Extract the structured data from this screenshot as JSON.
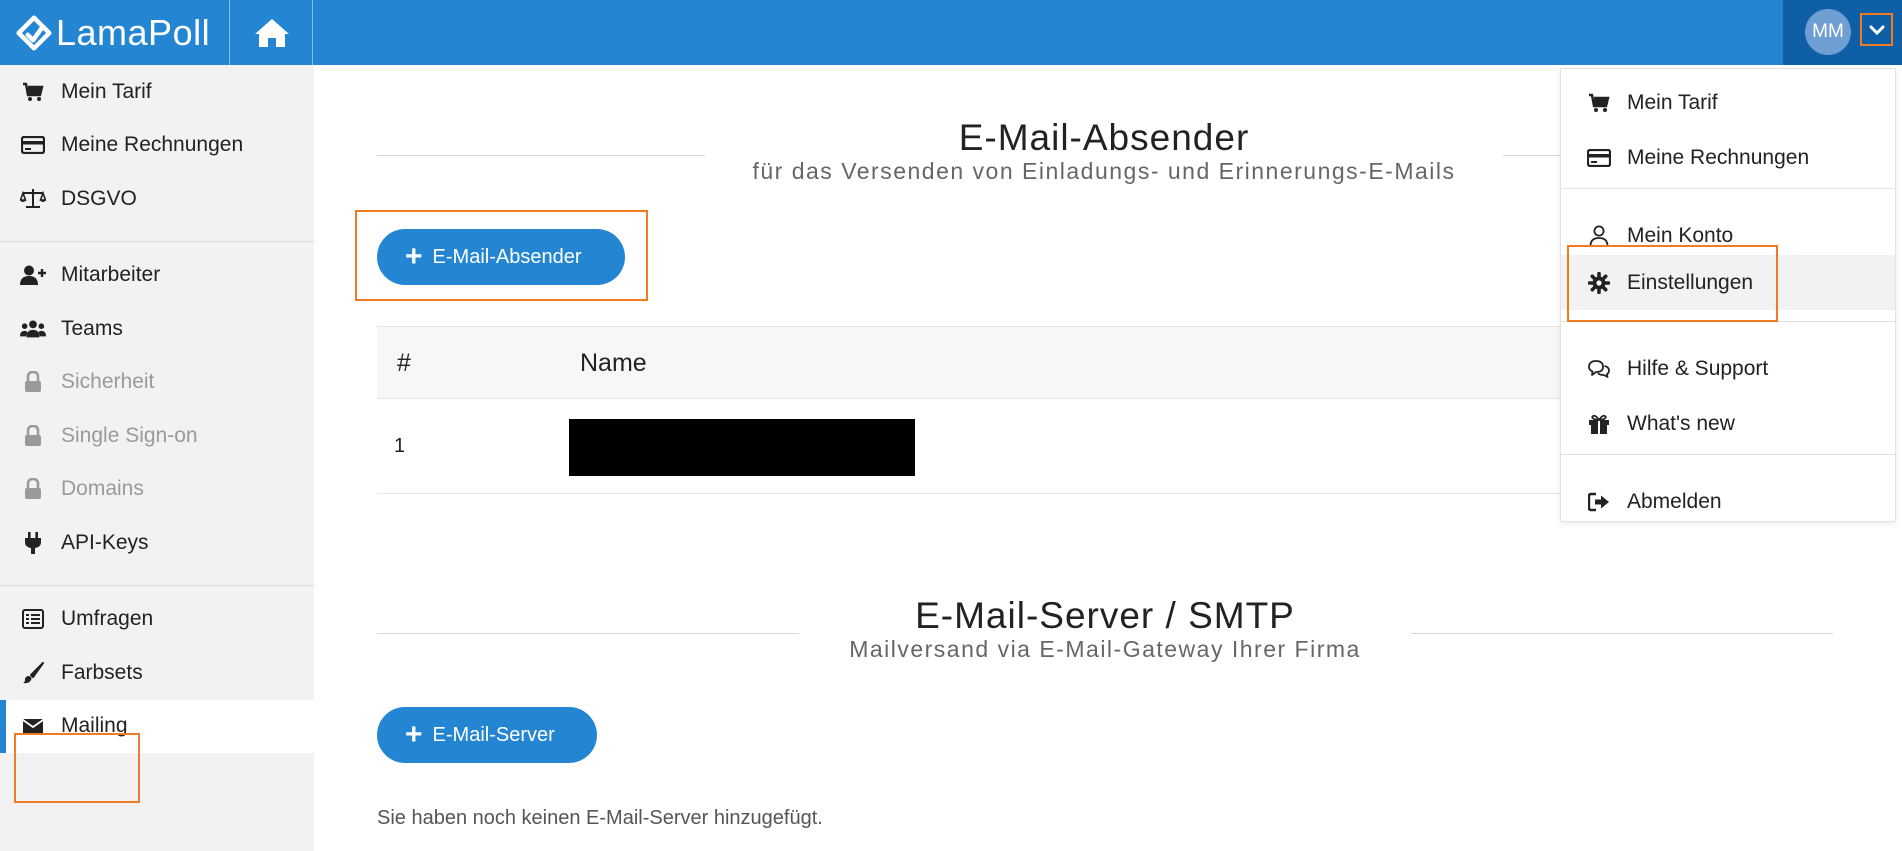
{
  "brand": {
    "name": "LamaPoll"
  },
  "user": {
    "initials": "MM"
  },
  "colors": {
    "primary": "#2486d2",
    "highlight": "#f07b22",
    "user_area": "#0e5fa5"
  },
  "sidebar": {
    "groups": [
      [
        {
          "label": "Mein Tarif",
          "icon": "cart-icon"
        },
        {
          "label": "Meine Rechnungen",
          "icon": "credit-card-icon"
        },
        {
          "label": "DSGVO",
          "icon": "scale-icon"
        }
      ],
      [
        {
          "label": "Mitarbeiter",
          "icon": "user-plus-icon"
        },
        {
          "label": "Teams",
          "icon": "users-icon"
        },
        {
          "label": "Sicherheit",
          "icon": "lock-icon",
          "disabled": true
        },
        {
          "label": "Single Sign-on",
          "icon": "lock-icon",
          "disabled": true
        },
        {
          "label": "Domains",
          "icon": "lock-icon",
          "disabled": true
        },
        {
          "label": "API-Keys",
          "icon": "plug-icon"
        }
      ],
      [
        {
          "label": "Umfragen",
          "icon": "list-icon"
        },
        {
          "label": "Farbsets",
          "icon": "brush-icon"
        },
        {
          "label": "Mailing",
          "icon": "envelope-icon",
          "active": true
        }
      ]
    ]
  },
  "main": {
    "sender": {
      "title": "E-Mail-Absender",
      "subtitle": "für das Versenden von Einladungs- und Erinnerungs-E-Mails",
      "add_button": "E-Mail-Absender",
      "table": {
        "headers": [
          "#",
          "Name"
        ],
        "rows": [
          {
            "num": "1",
            "name_redacted": true
          }
        ]
      }
    },
    "smtp": {
      "title": "E-Mail-Server / SMTP",
      "subtitle": "Mailversand via E-Mail-Gateway Ihrer Firma",
      "add_button": "E-Mail-Server",
      "empty_text": "Sie haben noch keinen E-Mail-Server hinzugefügt."
    }
  },
  "dropdown": {
    "items": [
      {
        "label": "Mein Tarif",
        "icon": "cart-icon"
      },
      {
        "label": "Meine Rechnungen",
        "icon": "credit-card-icon"
      },
      {
        "label": "Mein Konto",
        "icon": "user-icon"
      },
      {
        "label": "Einstellungen",
        "icon": "gear-icon",
        "hovered": true
      },
      {
        "label": "Hilfe & Support",
        "icon": "chat-icon"
      },
      {
        "label": "What's new",
        "icon": "gift-icon"
      },
      {
        "label": "Abmelden",
        "icon": "sign-out-icon"
      }
    ]
  }
}
